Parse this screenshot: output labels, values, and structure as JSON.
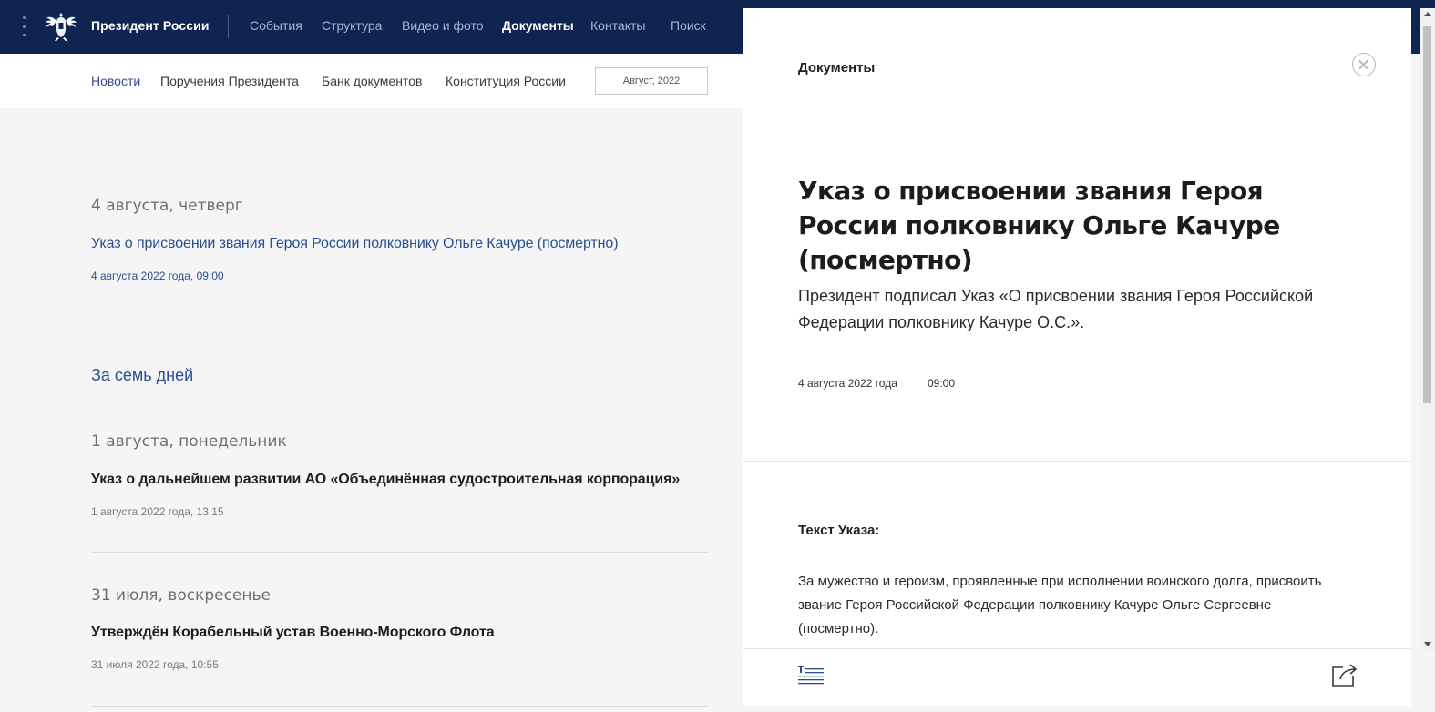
{
  "header": {
    "brand": "Президент России",
    "nav": [
      "События",
      "Структура",
      "Видео и фото",
      "Документы",
      "Контакты",
      "Поиск"
    ],
    "active_nav": "Документы",
    "menu_icon": "menu-dots-icon",
    "emblem_icon": "double-headed-eagle-icon",
    "background": "#0f2451"
  },
  "subnav": {
    "items": [
      "Новости",
      "Поручения Президента",
      "Банк документов",
      "Конституция России"
    ],
    "active": "Новости",
    "date_filter": "Август, 2022"
  },
  "feed": {
    "days": [
      {
        "heading": "4 августа, четверг",
        "title": "Указ о присвоении звания Героя России полковнику Ольге Качуре (посмертно)",
        "meta": "4 августа 2022 года, 09:00"
      }
    ],
    "section_heading": "За семь дней",
    "week": [
      {
        "heading": "1 августа, понедельник",
        "title": "Указ о дальнейшем развитии АО «Объединённая судостроительная корпорация»",
        "meta": "1 августа 2022 года, 13:15"
      },
      {
        "heading": "31 июля, воскресенье",
        "title": "Утверждён Корабельный устав Военно-Морского Флота",
        "meta": "31 июля 2022 года, 10:55"
      }
    ]
  },
  "panel": {
    "label": "Документы",
    "title": "Указ о присвоении звания Героя России полковнику Ольге Качуре (посмертно)",
    "lead": "Президент подписал Указ «О присвоении звания Героя Российской Федерации полковнику Качуре О.С.».",
    "date": "4 августа 2022 года",
    "time": "09:00",
    "decree_label": "Текст Указа:",
    "decree_text": "За мужество и героизм, проявленные при исполнении воинского долга, присвоить звание Героя Российской Федерации полковнику Качуре Ольге Сергеевне (посмертно).",
    "footer_icons": [
      "text-version-icon",
      "share-icon"
    ],
    "close_icon": "close-icon"
  },
  "colors": {
    "accent_link": "#2a4f8f",
    "panel_separator": "#d8ece9"
  }
}
